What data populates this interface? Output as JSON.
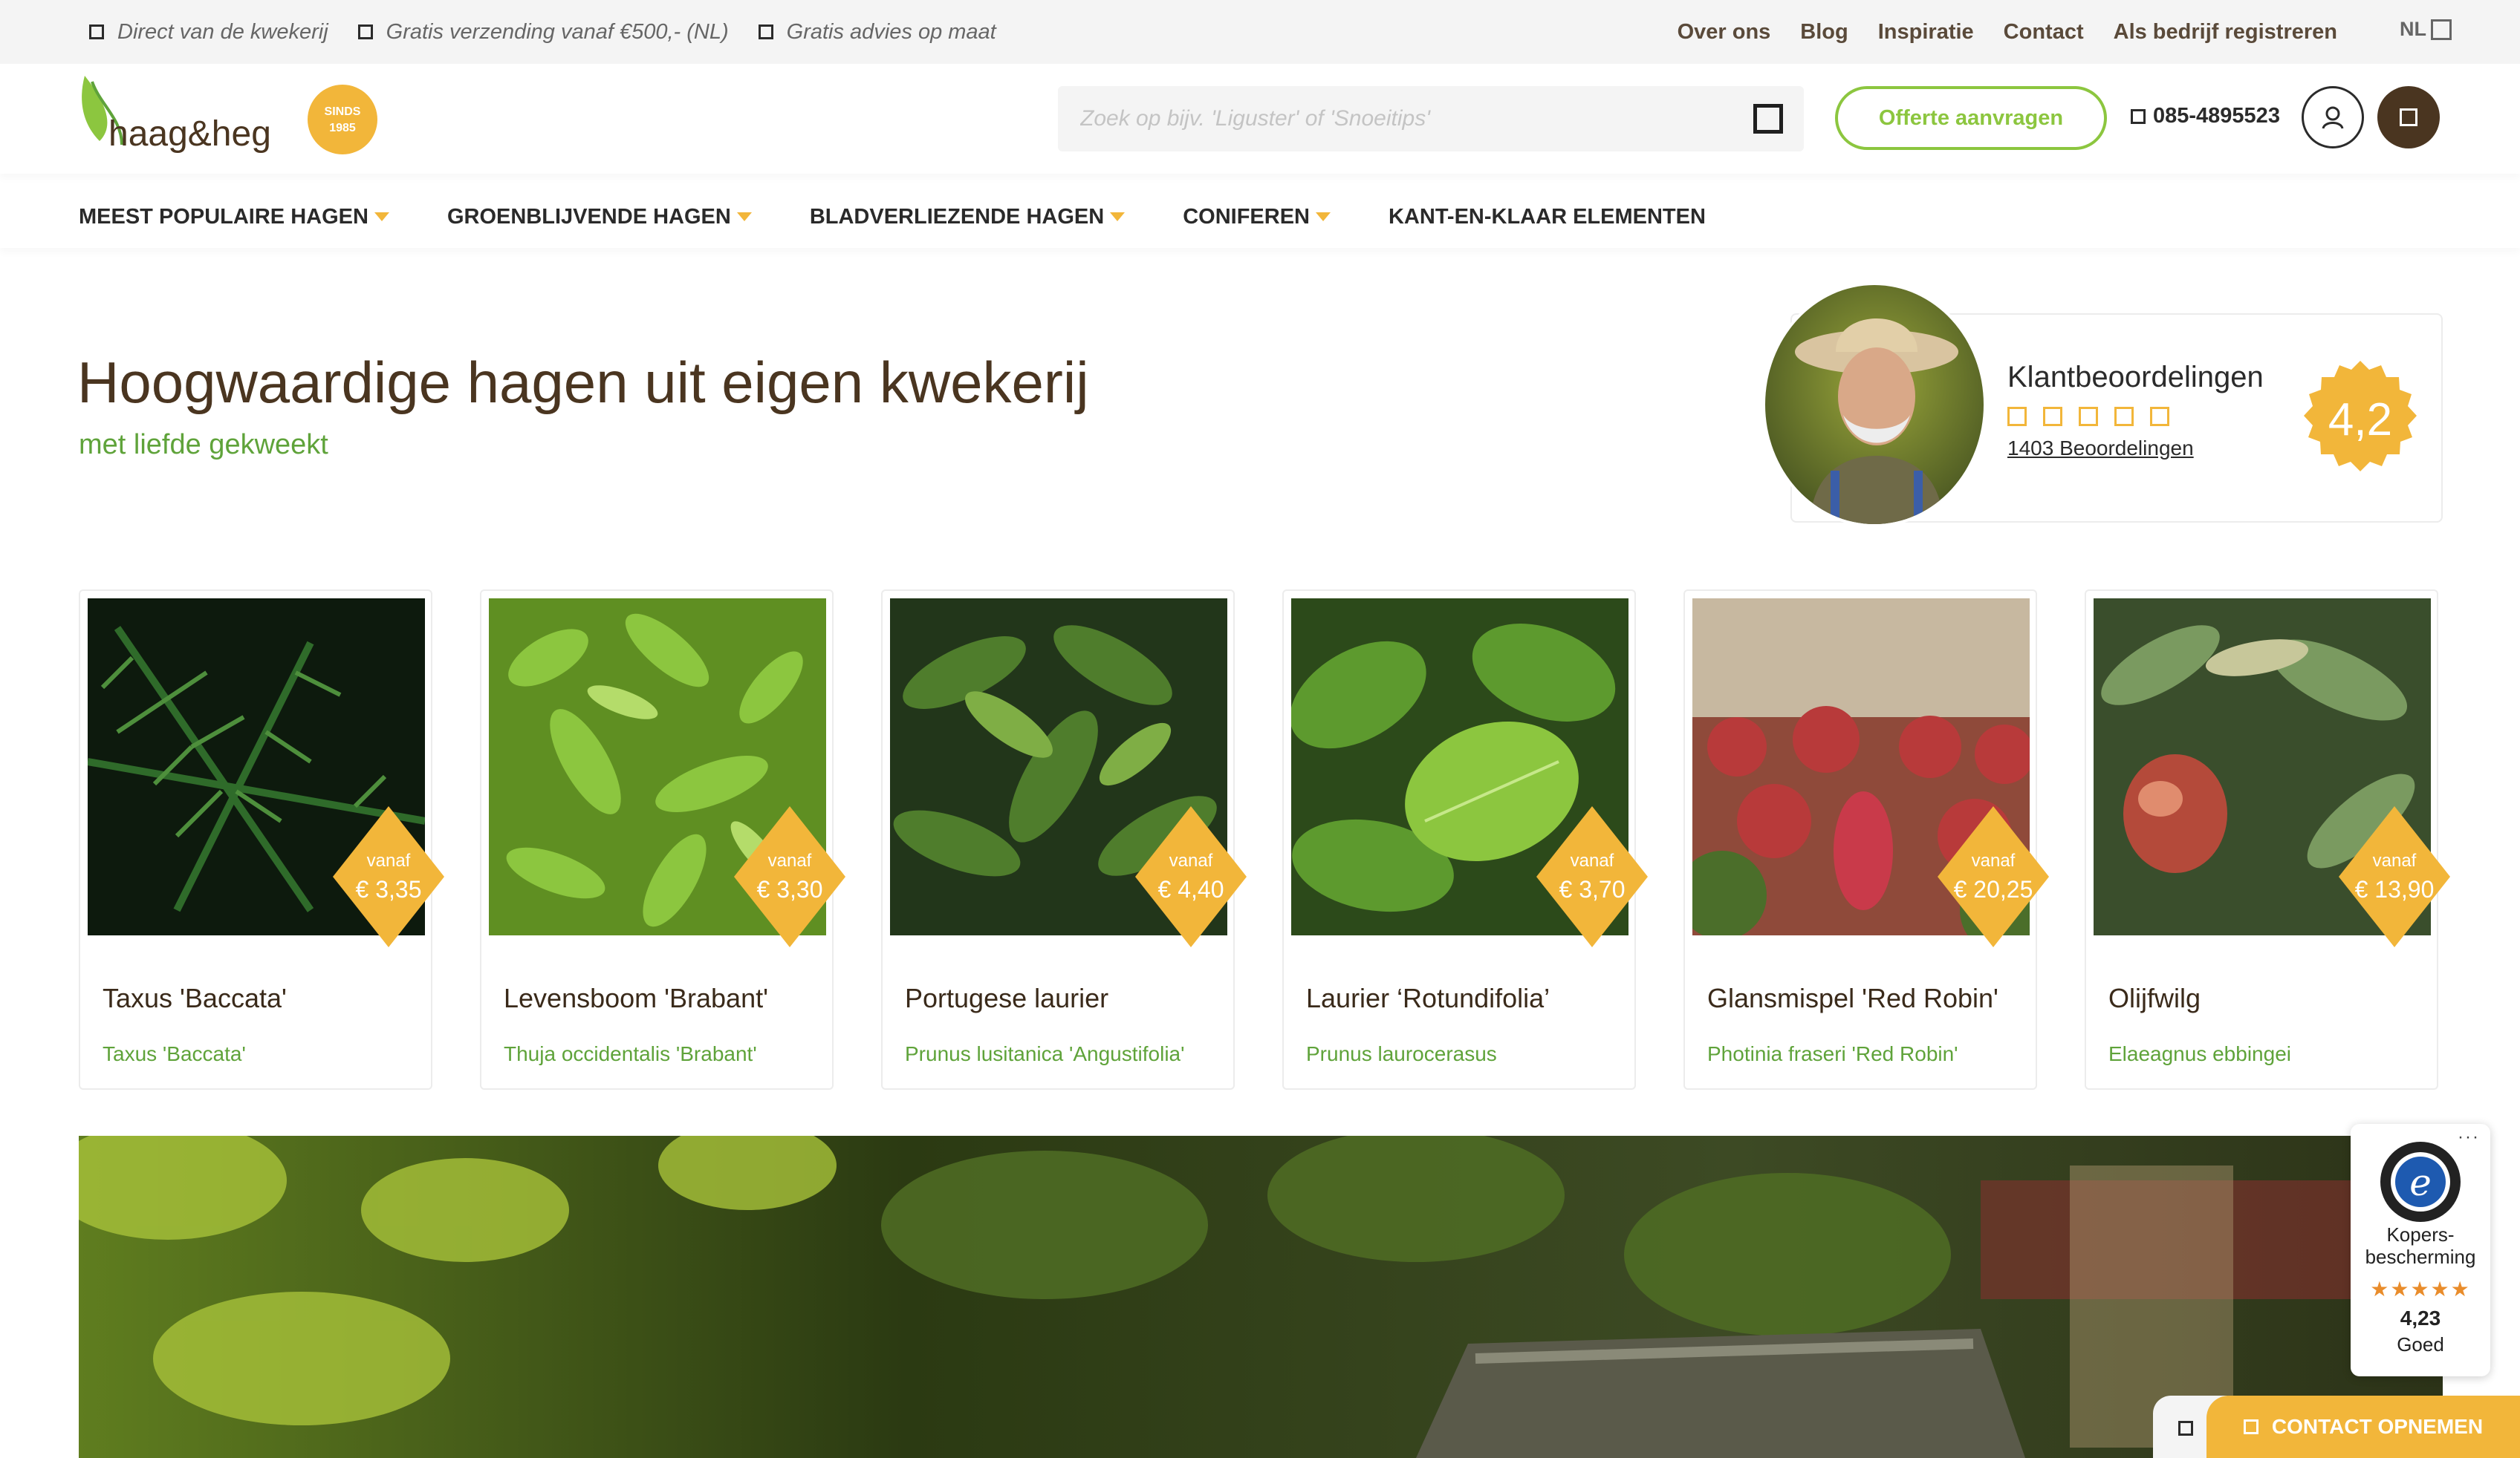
{
  "topbar": {
    "usps": [
      "Direct van de kwekerij",
      "Gratis verzending vanaf €500,- (NL)",
      "Gratis advies op maat"
    ],
    "links": [
      "Over ons",
      "Blog",
      "Inspiratie",
      "Contact",
      "Als bedrijf registreren"
    ],
    "language": "NL"
  },
  "header": {
    "logo_text": "haag&heg",
    "badge_line1": "SINDS",
    "badge_line2": "1985",
    "search_placeholder": "Zoek op bijv. 'Liguster' of 'Snoeitips'",
    "quote_button": "Offerte aanvragen",
    "phone": "085-4895523"
  },
  "nav": [
    {
      "label": "MEEST POPULAIRE HAGEN",
      "has_dropdown": true
    },
    {
      "label": "GROENBLIJVENDE HAGEN",
      "has_dropdown": true
    },
    {
      "label": "BLADVERLIEZENDE HAGEN",
      "has_dropdown": true
    },
    {
      "label": "CONIFEREN",
      "has_dropdown": true
    },
    {
      "label": "KANT-EN-KLAAR ELEMENTEN",
      "has_dropdown": false
    }
  ],
  "hero": {
    "title": "Hoogwaardige hagen uit eigen kwekerij",
    "subtitle": "met liefde gekweekt"
  },
  "reviews": {
    "title": "Klantbeoordelingen",
    "count_text": "1403 Beoordelingen",
    "score": "4,2"
  },
  "products": [
    {
      "name": "Taxus 'Baccata'",
      "latin": "Taxus 'Baccata'",
      "vanaf": "vanaf",
      "price": "€ 3,35"
    },
    {
      "name": "Levensboom 'Brabant'",
      "latin": "Thuja occidentalis 'Brabant'",
      "vanaf": "vanaf",
      "price": "€ 3,30"
    },
    {
      "name": "Portugese laurier",
      "latin": "Prunus lusitanica 'Angustifolia'",
      "vanaf": "vanaf",
      "price": "€ 4,40"
    },
    {
      "name": "Laurier ‘Rotundifolia’",
      "latin": "Prunus laurocerasus",
      "vanaf": "vanaf",
      "price": "€ 3,70"
    },
    {
      "name": "Glansmispel 'Red Robin'",
      "latin": "Photinia fraseri 'Red Robin'",
      "vanaf": "vanaf",
      "price": "€ 20,25"
    },
    {
      "name": "Olijfwilg",
      "latin": "Elaeagnus ebbingei",
      "vanaf": "vanaf",
      "price": "€ 13,90"
    }
  ],
  "trusted_shops": {
    "label_line1": "Kopers-",
    "label_line2": "bescherming",
    "stars": "★★★★★",
    "score": "4,23",
    "rating_label": "Goed"
  },
  "contact_button": "CONTACT OPNEMEN",
  "colors": {
    "accent_yellow": "#f2b63a",
    "brand_green": "#8cc63f",
    "latin_green": "#5fa33a",
    "brown": "#4a3520"
  }
}
